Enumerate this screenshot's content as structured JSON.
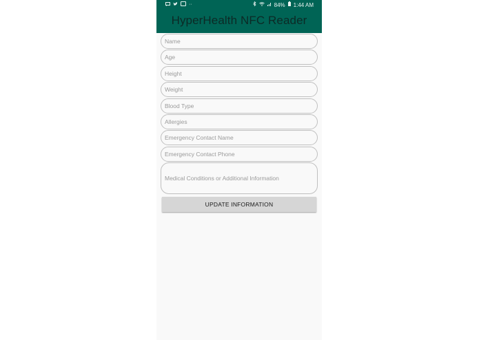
{
  "status_bar": {
    "left_icons": [
      "message-icon",
      "twitter-icon",
      "mail-icon",
      "more-icon"
    ],
    "bluetooth_icon": "bluetooth-icon",
    "wifi_icon": "wifi-icon",
    "signal_icon": "signal-icon",
    "battery": "84%",
    "battery_icon": "battery-icon",
    "time": "1:44 AM"
  },
  "app_bar": {
    "title": "HyperHealth NFC Reader"
  },
  "form": {
    "fields": [
      {
        "placeholder": "Name",
        "value": ""
      },
      {
        "placeholder": "Age",
        "value": ""
      },
      {
        "placeholder": "Height",
        "value": ""
      },
      {
        "placeholder": "Weight",
        "value": ""
      },
      {
        "placeholder": "Blood Type",
        "value": ""
      },
      {
        "placeholder": "Allergies",
        "value": ""
      },
      {
        "placeholder": "Emergency Contact Name",
        "value": ""
      },
      {
        "placeholder": "Emergency Contact Phone",
        "value": ""
      }
    ],
    "notes": {
      "placeholder": "Medical Conditions or Additional Information",
      "value": ""
    }
  },
  "update_button": {
    "label": "UPDATE INFORMATION"
  },
  "colors": {
    "app_bar": "#006455",
    "background": "#f9f9f9",
    "button": "#d6d6d6"
  }
}
